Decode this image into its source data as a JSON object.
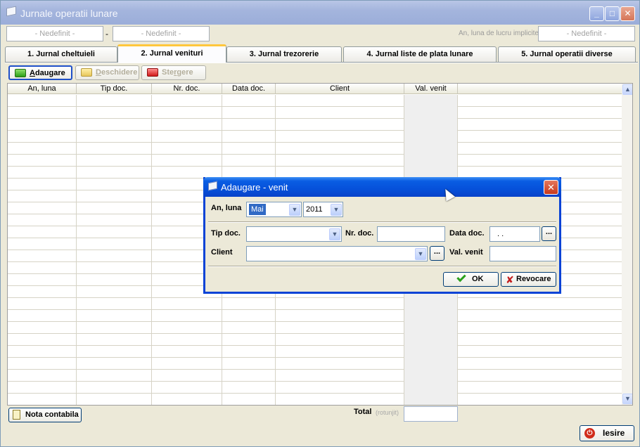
{
  "window": {
    "title": "Jurnale operatii lunare",
    "minimize_label": "_",
    "maximize_label": "□",
    "close_label": "✕"
  },
  "filters": {
    "period_from": "- Nedefinit -",
    "separator": "-",
    "period_to": "- Nedefinit -",
    "implicit_label": "An, luna de lucru implicite",
    "implicit_value": "- Nedefinit -"
  },
  "tabs": [
    {
      "label": "1. Jurnal cheltuieli",
      "active": false
    },
    {
      "label": "2. Jurnal venituri",
      "active": true
    },
    {
      "label": "3. Jurnal trezorerie",
      "active": false
    },
    {
      "label": "4. Jurnal liste de plata lunare",
      "active": false
    },
    {
      "label": "5. Jurnal operatii diverse",
      "active": false
    }
  ],
  "toolbar": {
    "add_first": "A",
    "add_rest": "daugare",
    "open_first": "D",
    "open_rest": "eschidere",
    "delete_pre": "Ste",
    "delete_u": "r",
    "delete_post": "gere"
  },
  "grid": {
    "columns": [
      "An, luna",
      "Tip doc.",
      "Nr. doc.",
      "Data doc.",
      "Client",
      "Val. venit"
    ],
    "rows": []
  },
  "footer": {
    "nota_label": "Nota contabila",
    "total_label": "Total",
    "rotunjit_label": "(rotunjit)",
    "total_value": "",
    "exit_label": "Iesire"
  },
  "dialog": {
    "title": "Adaugare - venit",
    "close_label": "✕",
    "an_luna_label": "An, luna",
    "month_value": "Mai",
    "year_value": "2011",
    "tip_doc_label": "Tip doc.",
    "tip_doc_value": "",
    "nr_doc_label": "Nr. doc.",
    "nr_doc_value": "",
    "data_doc_label": "Data doc.",
    "data_doc_value": ". .",
    "client_label": "Client",
    "client_value": "",
    "val_venit_label": "Val. venit",
    "val_venit_value": "",
    "dots_label": "...",
    "ok_label": "OK",
    "cancel_label": "Revocare"
  },
  "icons": {
    "dropdown": "▼",
    "scroll_up": "▲",
    "scroll_down": "▼",
    "power": "⏻",
    "cancel_x": "✘"
  }
}
